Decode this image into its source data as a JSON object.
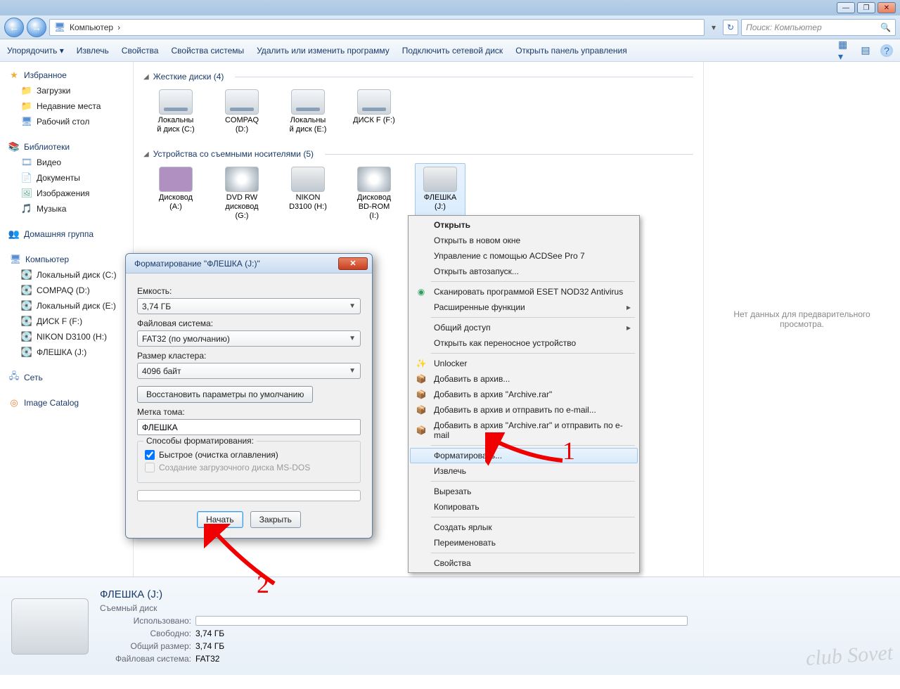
{
  "window": {
    "min": "—",
    "max": "❐",
    "close": "✕"
  },
  "nav": {
    "back": "←",
    "fwd": "→",
    "crumb_icon": "🖥",
    "crumb": "Компьютер",
    "sep": "›",
    "refresh": "↻"
  },
  "search": {
    "placeholder": "Поиск: Компьютер",
    "mag": "🔍"
  },
  "toolbar": {
    "organize": "Упорядочить ▾",
    "extract": "Извлечь",
    "props": "Свойства",
    "sysprops": "Свойства системы",
    "uninstall": "Удалить или изменить программу",
    "mapdrive": "Подключить сетевой диск",
    "cpanel": "Открыть панель управления"
  },
  "sidebar": {
    "fav": "Избранное",
    "dl": "Загрузки",
    "recent": "Недавние места",
    "desktop": "Рабочий стол",
    "libs": "Библиотеки",
    "video": "Видео",
    "docs": "Документы",
    "images": "Изображения",
    "music": "Музыка",
    "homegroup": "Домашняя группа",
    "computer": "Компьютер",
    "drives": [
      "Локальный диск (C:)",
      "COMPAQ (D:)",
      "Локальный диск (E:)",
      "ДИСК F (F:)",
      "NIKON D3100 (H:)",
      "ФЛЕШКА (J:)"
    ],
    "network": "Сеть",
    "imgcat": "Image Catalog"
  },
  "content": {
    "hdd_head": "Жесткие диски (4)",
    "hdd": [
      {
        "label": "Локальны\nй диск (C:)"
      },
      {
        "label": "COMPAQ\n(D:)"
      },
      {
        "label": "Локальны\nй диск (E:)"
      },
      {
        "label": "ДИСК F (F:)"
      }
    ],
    "rem_head": "Устройства со съемными носителями (5)",
    "rem": [
      {
        "label": "Дисковод\n(A:)"
      },
      {
        "label": "DVD RW\nдисковод\n(G:)"
      },
      {
        "label": "NIKON\nD3100 (H:)"
      },
      {
        "label": "Дисковод\nBD-ROM\n(I:)"
      },
      {
        "label": "ФЛЕШКА\n(J:)"
      }
    ],
    "preview": "Нет данных для предварительного\nпросмотра."
  },
  "ctx": {
    "open": "Открыть",
    "openwin": "Открыть в новом окне",
    "acdsee": "Управление с помощью ACDSee Pro 7",
    "autoplay": "Открыть автозапуск...",
    "eset": "Сканировать программой ESET NOD32 Antivirus",
    "adv": "Расширенные функции",
    "share": "Общий доступ",
    "portable": "Открыть как переносное устройство",
    "unlocker": "Unlocker",
    "arch1": "Добавить в архив...",
    "arch2": "Добавить в архив \"Archive.rar\"",
    "arch3": "Добавить в архив и отправить по e-mail...",
    "arch4": "Добавить в архив \"Archive.rar\" и отправить по e-mail",
    "format": "Форматировать...",
    "eject": "Извлечь",
    "cut": "Вырезать",
    "copy": "Копировать",
    "shortcut": "Создать ярлык",
    "rename": "Переименовать",
    "props": "Свойства"
  },
  "dialog": {
    "title": "Форматирование \"ФЛЕШКА (J:)\"",
    "capacity_l": "Емкость:",
    "capacity_v": "3,74 ГБ",
    "fs_l": "Файловая система:",
    "fs_v": "FAT32 (по умолчанию)",
    "cluster_l": "Размер кластера:",
    "cluster_v": "4096 байт",
    "restore": "Восстановить параметры по умолчанию",
    "label_l": "Метка тома:",
    "label_v": "ФЛЕШКА",
    "methods": "Способы форматирования:",
    "quick": "Быстрое (очистка оглавления)",
    "msdos": "Создание загрузочного диска MS-DOS",
    "start": "Начать",
    "close": "Закрыть"
  },
  "annot": {
    "one": "1",
    "two": "2"
  },
  "details": {
    "title": "ФЛЕШКА (J:)",
    "sub": "Съемный диск",
    "used_l": "Использовано:",
    "free_l": "Свободно:",
    "free_v": "3,74 ГБ",
    "total_l": "Общий размер:",
    "total_v": "3,74 ГБ",
    "fs_l": "Файловая система:",
    "fs_v": "FAT32"
  },
  "watermark": "club Sovet"
}
